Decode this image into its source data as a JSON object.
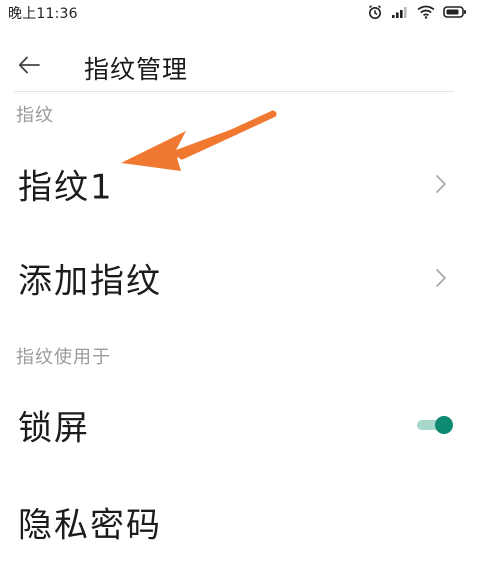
{
  "status_bar": {
    "time": "晚上11:36",
    "icons": [
      "alarm-icon",
      "signal-icon",
      "wifi-icon",
      "battery-icon"
    ]
  },
  "header": {
    "title": "指纹管理",
    "back_icon": "back-arrow-icon"
  },
  "sections": {
    "fingerprints_header": "指纹",
    "usage_header": "指纹使用于"
  },
  "rows": {
    "fingerprint1": "指纹1",
    "add_fingerprint": "添加指纹",
    "lock_screen": "锁屏",
    "privacy_password": "隐私密码"
  },
  "toggles": {
    "lock_screen": true
  },
  "colors": {
    "accent": "#0f8a72",
    "toggle_track": "#a8d8cc",
    "annotation_arrow": "#f07830",
    "section_text": "#9a9a9a"
  }
}
